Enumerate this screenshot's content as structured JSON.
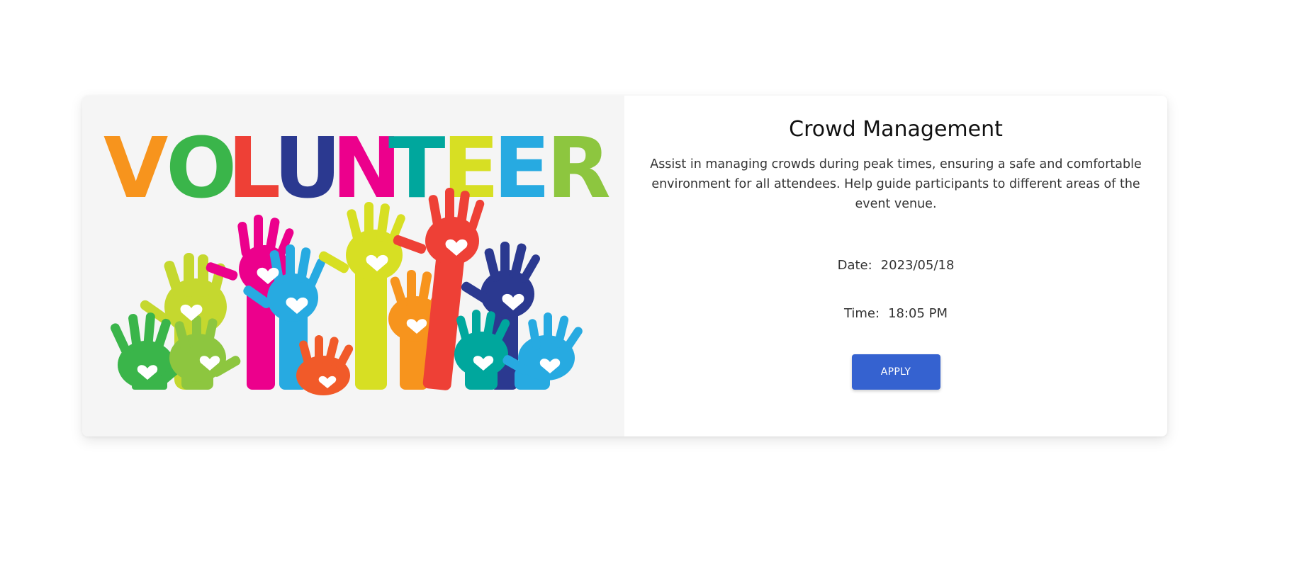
{
  "event": {
    "image_lettering": "VOLUNTEER",
    "title": "Crowd Management",
    "description": "Assist in managing crowds during peak times, ensuring a safe and comfortable environment for all attendees. Help guide participants to different areas of the event venue.",
    "date_label": "Date:",
    "date_value": "2023/05/18",
    "time_label": "Time:",
    "time_value": "18:05 PM",
    "apply_label": "APPLY"
  },
  "colors": {
    "apply_button": "#3562d0",
    "card_background": "#ffffff",
    "image_background": "#f5f5f5"
  }
}
